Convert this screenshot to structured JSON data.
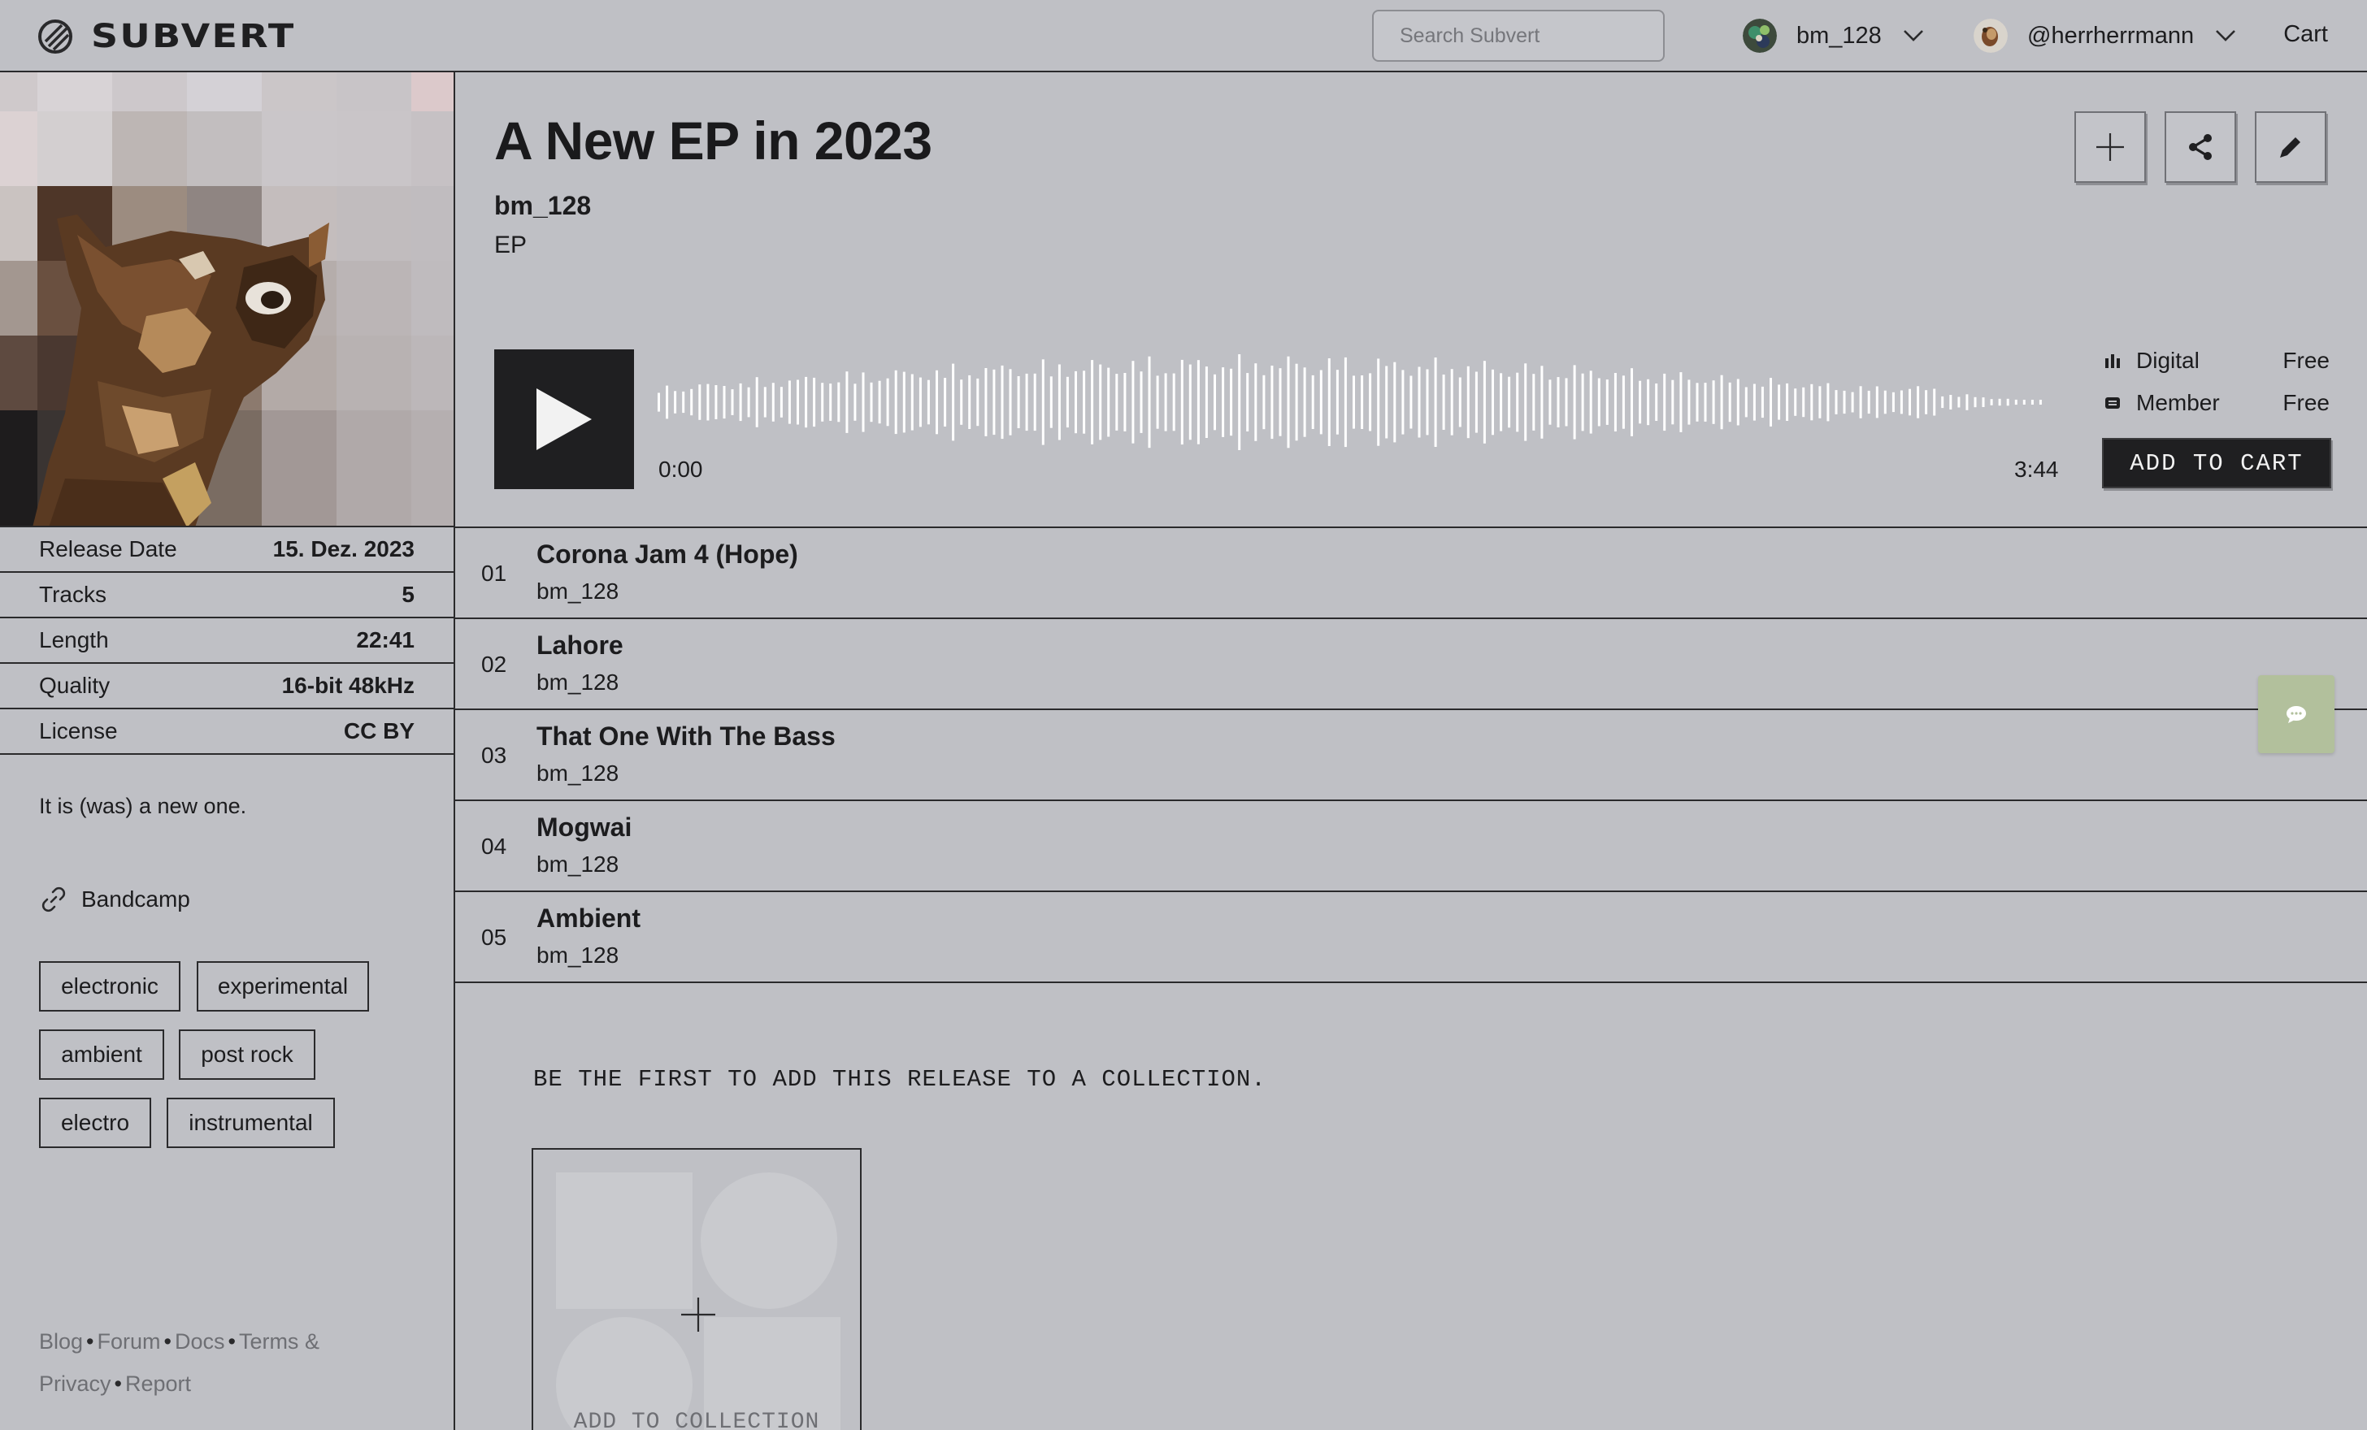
{
  "header": {
    "logo_text": "SUBVERT",
    "search_placeholder": "Search Subvert",
    "artist_account": "bm_128",
    "user_account": "@herrherrmann",
    "cart_label": "Cart"
  },
  "release": {
    "title": "A New EP in 2023",
    "artist": "bm_128",
    "type": "EP",
    "player": {
      "current_time": "0:00",
      "duration": "3:44",
      "progress": 0
    },
    "prices": [
      {
        "label": "Digital",
        "value": "Free",
        "icon": "bars-icon"
      },
      {
        "label": "Member",
        "value": "Free",
        "icon": "subvert-s-icon"
      }
    ],
    "add_to_cart_label": "ADD TO CART"
  },
  "details": [
    {
      "label": "Release Date",
      "value": "15. Dez. 2023"
    },
    {
      "label": "Tracks",
      "value": "5"
    },
    {
      "label": "Length",
      "value": "22:41"
    },
    {
      "label": "Quality",
      "value": "16-bit 48kHz"
    },
    {
      "label": "License",
      "value": "CC BY"
    }
  ],
  "description": "It is (was) a new one.",
  "external_link": "Bandcamp",
  "tags": [
    "electronic",
    "experimental",
    "ambient",
    "post rock",
    "electro",
    "instrumental"
  ],
  "tracks": [
    {
      "number": "01",
      "title": "Corona Jam 4 (Hope)",
      "artist": "bm_128"
    },
    {
      "number": "02",
      "title": "Lahore",
      "artist": "bm_128"
    },
    {
      "number": "03",
      "title": "That One With The Bass",
      "artist": "bm_128"
    },
    {
      "number": "04",
      "title": "Mogwai",
      "artist": "bm_128"
    },
    {
      "number": "05",
      "title": "Ambient",
      "artist": "bm_128"
    }
  ],
  "collection": {
    "message": "BE THE FIRST TO ADD THIS RELEASE TO A COLLECTION.",
    "add_label": "ADD TO COLLECTION"
  },
  "footer_links": [
    "Blog",
    "Forum",
    "Docs",
    "Terms & Privacy",
    "Report"
  ],
  "colors": {
    "background": "#bfc0c5",
    "ink": "#1f1f21",
    "chat_button": "#b2c09c",
    "muted_link": "#6e6f74"
  }
}
